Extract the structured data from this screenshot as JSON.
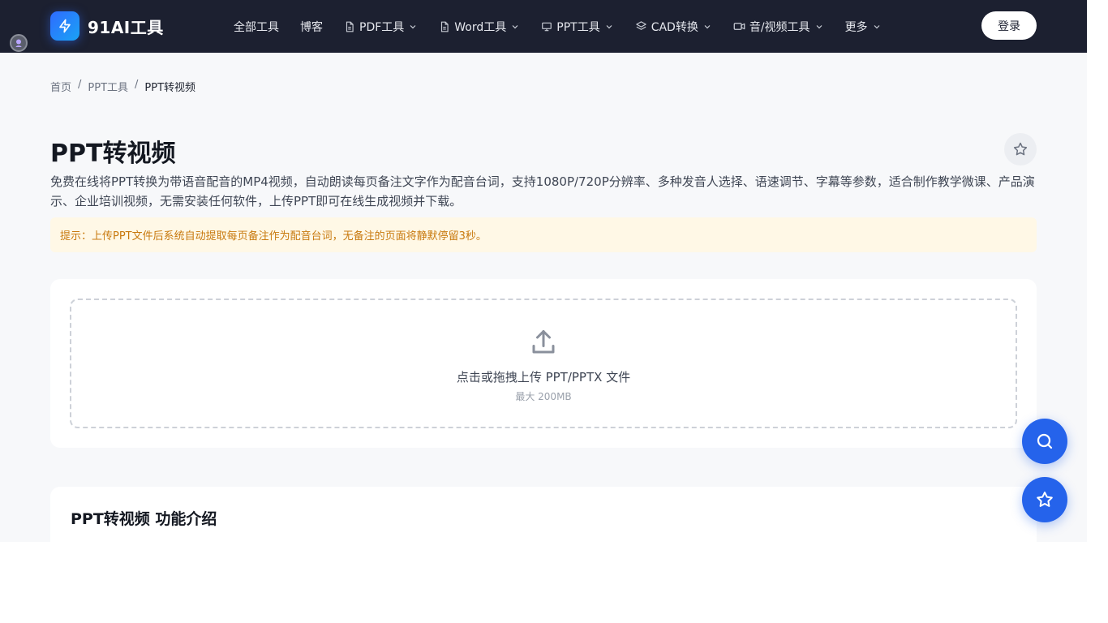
{
  "header": {
    "logo_text": "91AI工具",
    "nav": [
      {
        "label": "全部工具",
        "icon": null,
        "dropdown": false
      },
      {
        "label": "博客",
        "icon": null,
        "dropdown": false
      },
      {
        "label": "PDF工具",
        "icon": "document-icon",
        "dropdown": true
      },
      {
        "label": "Word工具",
        "icon": "document-icon",
        "dropdown": true
      },
      {
        "label": "PPT工具",
        "icon": "presentation-icon",
        "dropdown": true
      },
      {
        "label": "CAD转换",
        "icon": "layers-icon",
        "dropdown": true
      },
      {
        "label": "音/视频工具",
        "icon": "video-icon",
        "dropdown": true
      },
      {
        "label": "更多",
        "icon": null,
        "dropdown": true
      }
    ],
    "login_label": "登录"
  },
  "breadcrumb": {
    "home": "首页",
    "category": "PPT工具",
    "current": "PPT转视频",
    "separator": "/"
  },
  "page": {
    "title": "PPT转视频",
    "description": "免费在线将PPT转换为带语音配音的MP4视频，自动朗读每页备注文字作为配音台词，支持1080P/720P分辨率、多种发音人选择、语速调节、字幕等参数，适合制作教学微课、产品演示、企业培训视频，无需安装任何软件，上传PPT即可在线生成视频并下载。",
    "tip": "提示：上传PPT文件后系统自动提取每页备注作为配音台词，无备注的页面将静默停留3秒。"
  },
  "upload": {
    "text": "点击或拖拽上传 PPT/PPTX 文件",
    "limit": "最大 200MB"
  },
  "intro": {
    "title": "PPT转视频 功能介绍"
  },
  "colors": {
    "header_bg": "#1c2030",
    "accent": "#2563eb",
    "tip_bg": "#fff8e6",
    "tip_text": "#c8790e"
  }
}
